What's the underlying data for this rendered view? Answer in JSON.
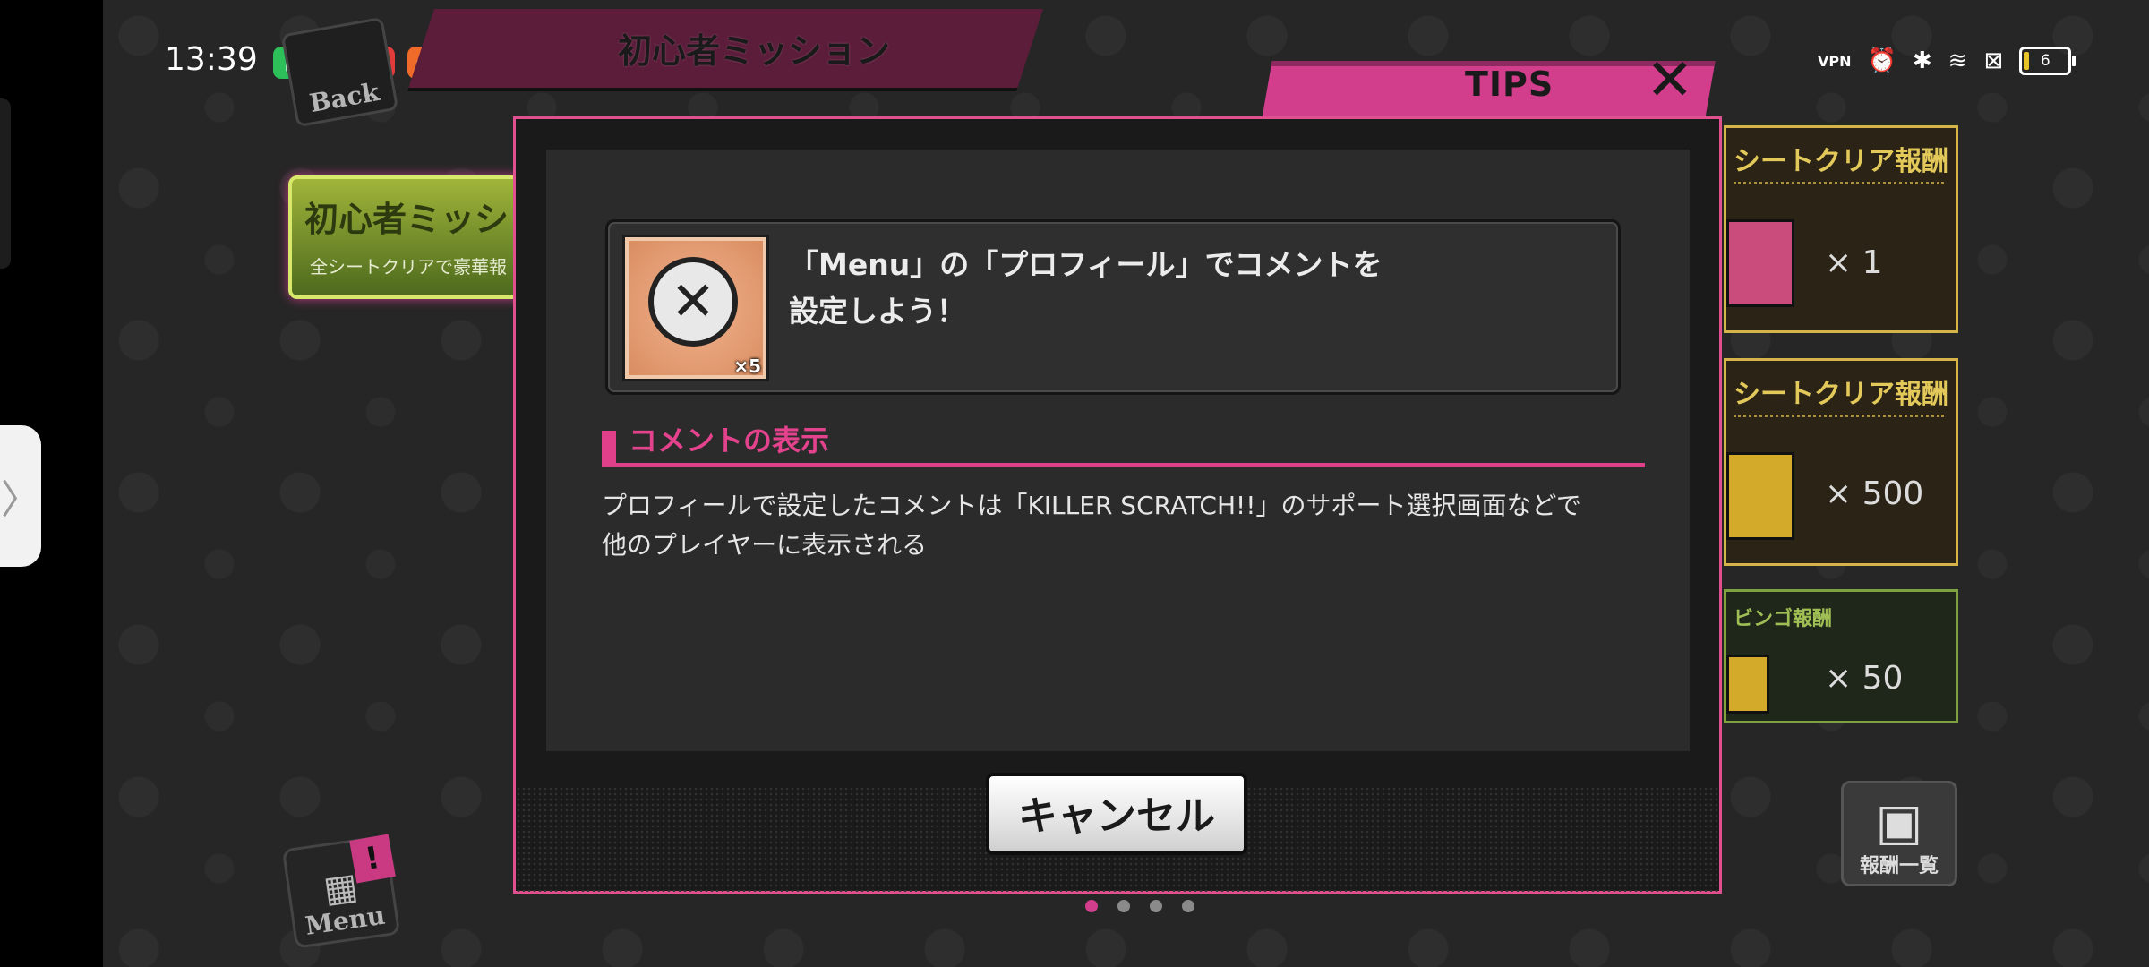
{
  "status": {
    "time": "13:39",
    "apps": [
      {
        "icon": "battery-app-icon",
        "color": "#2dbf5a",
        "glyph": "▮"
      },
      {
        "icon": "qq-penguin-icon",
        "color": "#1fa3e8",
        "glyph": "●"
      },
      {
        "icon": "netease-music-icon",
        "color": "#e13b3b",
        "glyph": "◉"
      },
      {
        "icon": "orange-app-icon",
        "color": "#f06a2a",
        "glyph": "✿"
      },
      {
        "icon": "game-app-icon",
        "color": "#d9d9d9",
        "glyph": "★"
      }
    ],
    "vpn": "VPN",
    "battery_level": "6"
  },
  "header": {
    "back_label": "Back",
    "mission_title": "初心者ミッション",
    "tips_label": "TIPS"
  },
  "background": {
    "beginner_title": "初心者ミッシ",
    "beginner_subtitle": "全シートクリアで豪華報"
  },
  "rewards": [
    {
      "label": "シートクリア報酬",
      "qty": "× 1"
    },
    {
      "label": "シートクリア報酬",
      "qty": "× 500"
    },
    {
      "label": "ビンゴ報酬",
      "qty": "× 50"
    }
  ],
  "reward_list_label": "報酬一覧",
  "menu_label": "Menu",
  "menu_badge": "!",
  "dialog": {
    "mission_text": "「Menu」の「プロフィール」でコメントを\n設定しよう！",
    "item_count": "×5",
    "section_title": "コメントの表示",
    "section_body": "プロフィールで設定したコメントは「KILLER SCRATCH!!」のサポート選択画面などで\n他のプレイヤーに表示される",
    "cancel_label": "キャンセル"
  },
  "pager": {
    "pages": 4,
    "current": 1
  },
  "colors": {
    "accent": "#e0408a",
    "gold": "#d5b54a",
    "green": "#7fa241"
  }
}
